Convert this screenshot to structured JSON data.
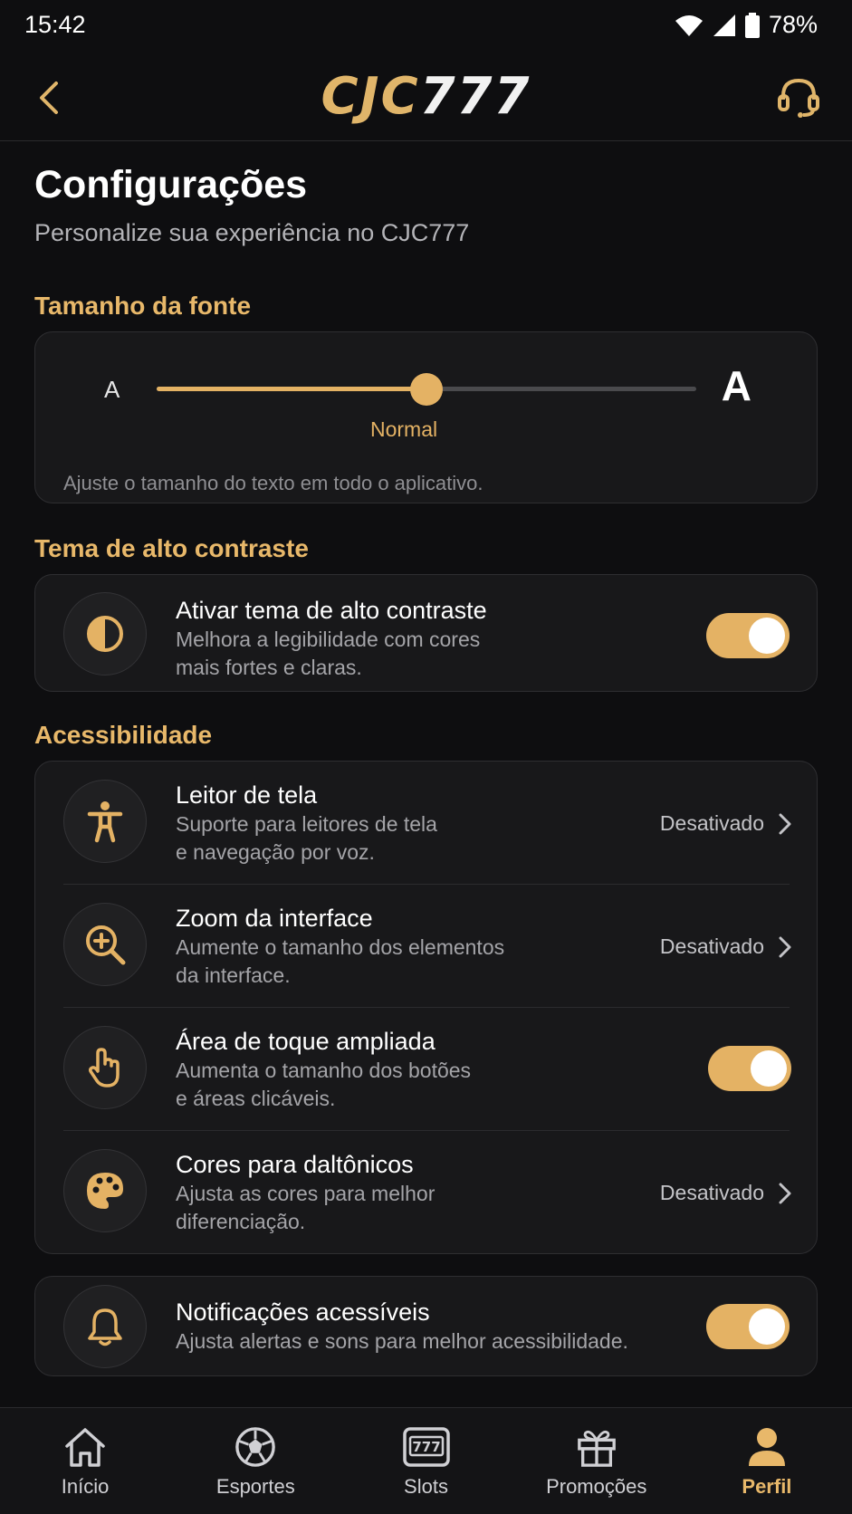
{
  "status_bar": {
    "time": "15:42",
    "battery": "78%"
  },
  "header": {
    "logo_part1": "CJC",
    "logo_part2": "777"
  },
  "page": {
    "title": "Configurações",
    "subtitle": "Personalize sua experiência no CJC777"
  },
  "font_size": {
    "section_title": "Tamanho da fonte",
    "small_label": "A",
    "large_label": "A",
    "value_label": "Normal",
    "level": 0.5,
    "note": "Ajuste o tamanho do texto em todo o aplicativo."
  },
  "contrast": {
    "section_title": "Tema de alto contraste",
    "title": "Ativar tema de alto contraste",
    "desc_line1": "Melhora a legibilidade com cores",
    "desc_line2": "mais fortes e claras.",
    "enabled": true
  },
  "accessibility": {
    "section_title": "Acessibilidade",
    "items": [
      {
        "title": "Leitor de tela",
        "desc_line1": "Suporte para leitores de tela",
        "desc_line2": "e navegação por voz.",
        "value": "Desativado",
        "icon": "accessibility-person-icon"
      },
      {
        "title": "Zoom da interface",
        "desc_line1": "Aumente o tamanho dos elementos",
        "desc_line2": "da interface.",
        "value": "Desativado",
        "icon": "zoom-in-icon"
      },
      {
        "title": "Área de toque ampliada",
        "desc_line1": "Aumenta o tamanho dos botões",
        "desc_line2": "e áreas clicáveis.",
        "enabled": true,
        "icon": "touch-hand-icon"
      },
      {
        "title": "Cores para daltônicos",
        "desc_line1": "Ajusta as cores para melhor",
        "desc_line2": "diferenciação.",
        "value": "Desativado",
        "icon": "palette-icon"
      }
    ]
  },
  "notifications": {
    "title": "Notificações acessíveis",
    "desc": "Ajusta alertas e sons para melhor acessibilidade.",
    "enabled": true,
    "icon": "bell-icon"
  },
  "bottom_nav": {
    "items": [
      {
        "label": "Início",
        "icon": "home-icon"
      },
      {
        "label": "Esportes",
        "icon": "soccer-ball-icon"
      },
      {
        "label": "Slots",
        "icon": "slot-machine-icon"
      },
      {
        "label": "Promoções",
        "icon": "gift-icon"
      },
      {
        "label": "Perfil",
        "icon": "user-icon",
        "active": true
      }
    ]
  },
  "colors": {
    "accent": "#e4b264",
    "background": "#0e0e10",
    "card": "#18181a"
  }
}
